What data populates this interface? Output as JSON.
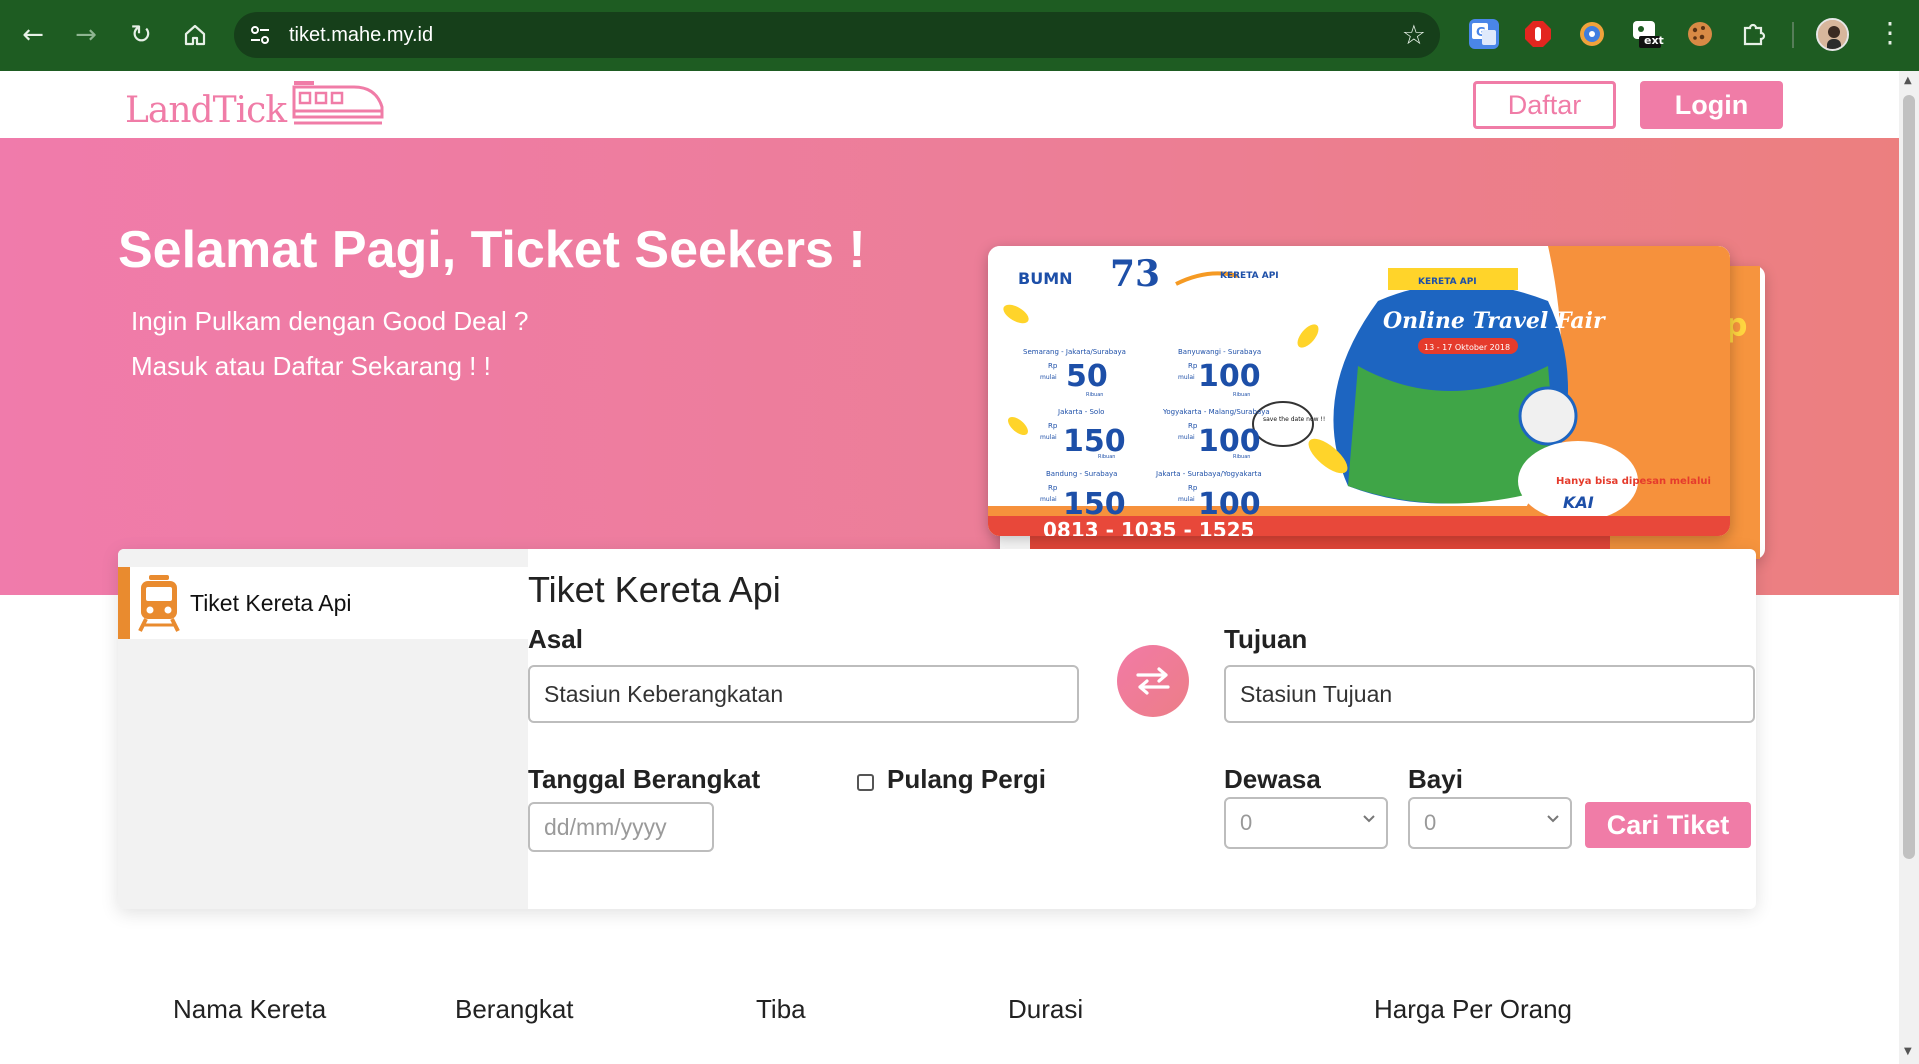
{
  "browser": {
    "url": "tiket.mahe.my.id",
    "ext_badge": "ext"
  },
  "header": {
    "logo_text": "LandTick",
    "daftar_label": "Daftar",
    "login_label": "Login"
  },
  "hero": {
    "title": "Selamat Pagi, Ticket Seekers !",
    "line1": "Ingin Pulkam dengan Good Deal ?",
    "line2": "Masuk atau Daftar Sekarang ! !"
  },
  "promo": {
    "bumn": "BUMN",
    "kereta_api": "KERETA API",
    "fair_title": "Online Travel Fair",
    "fair_date": "13 - 17 Oktober 2018",
    "save_date": "save the date now !!",
    "hanya": "Hanya bisa dipesan melalui",
    "kai": "KAI",
    "phone": "0813 - 1035 - 1525",
    "rp": "Rp",
    "mulai": "mulai",
    "ribuan": "Ribuan",
    "routes": [
      {
        "route": "Semarang - Jakarta/Surabaya",
        "price": "50"
      },
      {
        "route": "Banyuwangi - Surabaya",
        "price": "100"
      },
      {
        "route": "Jakarta - Solo",
        "price": "150"
      },
      {
        "route": "Yogyakarta - Malang/Surabaya",
        "price": "100"
      },
      {
        "route": "Bandung - Surabaya",
        "price": "150"
      },
      {
        "route": "Jakarta - Surabaya/Yogyakarta",
        "price": "100"
      }
    ]
  },
  "search": {
    "side_tab": "Tiket Kereta Api",
    "title": "Tiket Kereta Api",
    "asal_label": "Asal",
    "asal_value": "Stasiun Keberangkatan",
    "tujuan_label": "Tujuan",
    "tujuan_value": "Stasiun Tujuan",
    "tanggal_label": "Tanggal Berangkat",
    "tanggal_placeholder": "dd/mm/yyyy",
    "pulang_label": "Pulang Pergi",
    "dewasa_label": "Dewasa",
    "dewasa_value": "0",
    "bayi_label": "Bayi",
    "bayi_value": "0",
    "cari_label": "Cari Tiket"
  },
  "table_headers": [
    "Nama Kereta",
    "Berangkat",
    "Tiba",
    "Durasi",
    "Harga Per Orang"
  ],
  "colors": {
    "brand_pink": "#f07ca7",
    "accent_orange": "#e98b2f",
    "chrome_green": "#1e5c22"
  }
}
